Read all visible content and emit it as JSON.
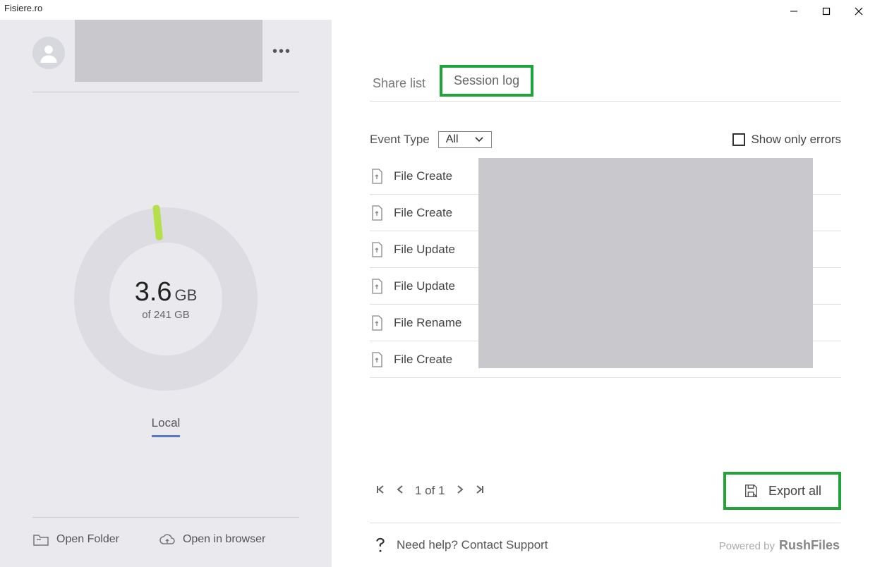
{
  "window": {
    "title": "Fisiere.ro"
  },
  "sidebar": {
    "usage_value": "3.6",
    "usage_unit": "GB",
    "usage_sub": "of 241 GB",
    "tab_local": "Local",
    "open_folder": "Open Folder",
    "open_browser": "Open in browser"
  },
  "tabs": {
    "share_list": "Share list",
    "session_log": "Session log"
  },
  "filters": {
    "event_type_label": "Event Type",
    "event_type_value": "All",
    "show_errors": "Show only errors"
  },
  "log": {
    "items": [
      "File Create",
      "File Create",
      "File Update",
      "File Update",
      "File Rename",
      "File Create"
    ]
  },
  "pager": {
    "text": "1 of 1"
  },
  "export": {
    "label": "Export all"
  },
  "footer": {
    "help": "Need help? Contact Support",
    "powered_prefix": "Powered by",
    "powered_brand": "RushFiles"
  }
}
